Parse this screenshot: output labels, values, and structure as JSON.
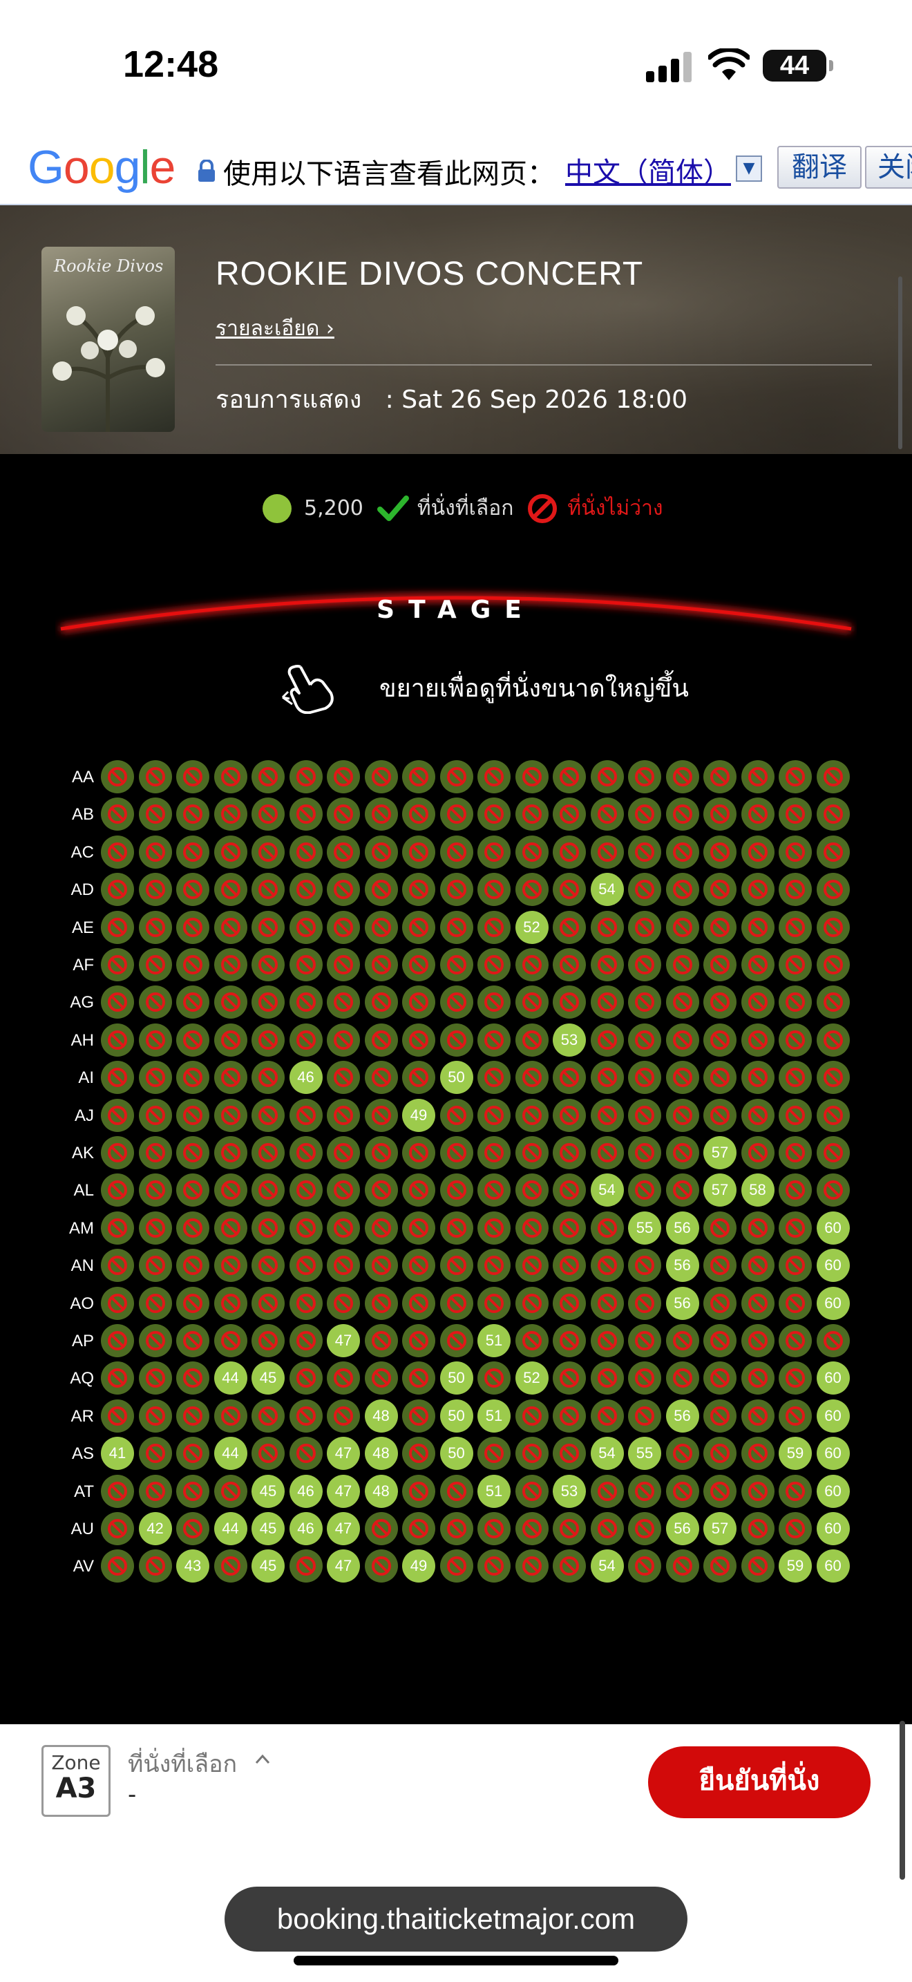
{
  "status_bar": {
    "time": "12:48",
    "battery": "44"
  },
  "translate_bar": {
    "google": "Google",
    "prompt": "使用以下语言查看此网页：",
    "language": "中文（简体）",
    "translate_label": "翻译",
    "close_label": "关闭"
  },
  "event": {
    "poster_title": "Rookie Divos",
    "title": "ROOKIE DIVOS CONCERT",
    "detail_link": "รายละเอียด ›",
    "showtime_label": "รอบการแสดง",
    "showtime_value": ": Sat 26 Sep 2026 18:00"
  },
  "legend": {
    "price": "5,200",
    "selected": "ที่นั่งที่เลือก",
    "not_available": "ที่นั่งไม่ว่าง",
    "price_color": "#8fc33b",
    "na_color": "#e01818"
  },
  "stage": {
    "label": "STAGE",
    "zoom_hint": "ขยายเพื่อดูที่นั่งขนาดใหญ่ขึ้น"
  },
  "seat_map": {
    "seats_per_row": 20,
    "first_seat_number": 41,
    "rows": [
      {
        "label": "AA",
        "available": []
      },
      {
        "label": "AB",
        "available": []
      },
      {
        "label": "AC",
        "available": []
      },
      {
        "label": "AD",
        "available": [
          54
        ]
      },
      {
        "label": "AE",
        "available": [
          52
        ]
      },
      {
        "label": "AF",
        "available": []
      },
      {
        "label": "AG",
        "available": []
      },
      {
        "label": "AH",
        "available": [
          53
        ]
      },
      {
        "label": "AI",
        "available": [
          46,
          50
        ]
      },
      {
        "label": "AJ",
        "available": [
          49
        ]
      },
      {
        "label": "AK",
        "available": [
          57
        ]
      },
      {
        "label": "AL",
        "available": [
          54,
          57,
          58
        ]
      },
      {
        "label": "AM",
        "available": [
          55,
          56,
          60
        ]
      },
      {
        "label": "AN",
        "available": [
          56,
          60
        ]
      },
      {
        "label": "AO",
        "available": [
          56,
          60
        ]
      },
      {
        "label": "AP",
        "available": [
          47,
          51
        ]
      },
      {
        "label": "AQ",
        "available": [
          44,
          45,
          50,
          52,
          60
        ]
      },
      {
        "label": "AR",
        "available": [
          48,
          50,
          51,
          56,
          60
        ]
      },
      {
        "label": "AS",
        "available": [
          41,
          44,
          47,
          48,
          50,
          54,
          55,
          59,
          60
        ]
      },
      {
        "label": "AT",
        "available": [
          45,
          46,
          47,
          48,
          51,
          53,
          60
        ]
      },
      {
        "label": "AU",
        "available": [
          42,
          44,
          45,
          46,
          47,
          56,
          57,
          60
        ]
      },
      {
        "label": "AV",
        "available": [
          43,
          45,
          47,
          49,
          54,
          59,
          60
        ]
      }
    ]
  },
  "bottom": {
    "zone_label": "Zone",
    "zone_value": "A3",
    "selected_label": "ที่นั่งที่เลือก",
    "selected_value": "-",
    "confirm_label": "ยืนยันที่นั่ง",
    "confirm_color": "#d20a0a"
  },
  "browser": {
    "url": "booking.thaiticketmajor.com"
  }
}
